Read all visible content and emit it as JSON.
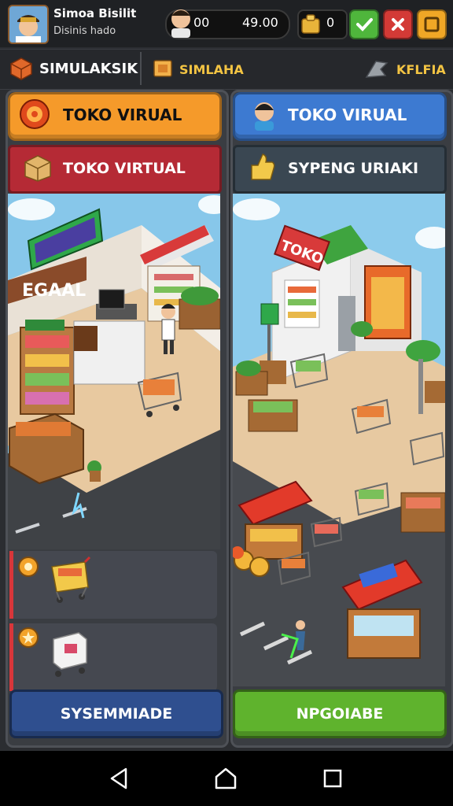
{
  "header": {
    "player_name": "Simoa Bisilit",
    "player_subtitle": "Disinis hado",
    "coins_left": "00",
    "coins_right": "49.00",
    "gems": "0"
  },
  "nav": {
    "left_label": "SIMULAKSIK",
    "center_label": "SIMLAHA",
    "right_label": "KFLFIA"
  },
  "left_panel": {
    "header_label": "TOKO VIRUAL",
    "sub_label": "TOKO VIRTUAL",
    "sign_text": "EGAAL",
    "bottom_label": "SYSEMMIADE"
  },
  "right_panel": {
    "header_label": "TOKO VIRUAL",
    "sub_label": "SYPENG URIAKI",
    "sign_text": "TOKO",
    "bottom_label": "NPGOIABE"
  },
  "colors": {
    "orange": "#f59a2a",
    "blue": "#3d7ad1",
    "red": "#b52a35",
    "slate": "#3a4752",
    "green": "#5fb32d",
    "navy": "#2f4f8f"
  }
}
